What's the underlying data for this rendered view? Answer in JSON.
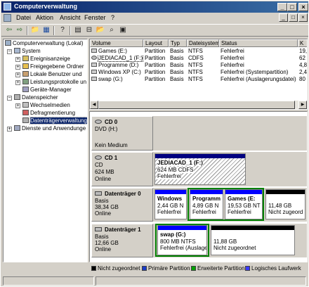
{
  "window": {
    "title": "Computerverwaltung"
  },
  "menu": {
    "items": [
      "Datei",
      "Aktion",
      "Ansicht",
      "Fenster",
      "?"
    ]
  },
  "tree": {
    "root": "Computerverwaltung (Lokal)",
    "system": "System",
    "system_children": [
      "Ereignisanzeige",
      "Freigegebene Ordner",
      "Lokale Benutzer und",
      "Leistungsprotokolle un",
      "Geräte-Manager"
    ],
    "storage": "Datenspeicher",
    "storage_children": [
      "Wechselmedien",
      "Defragmentierung",
      "Datenträgerverwaltung"
    ],
    "services": "Dienste und Anwendunge"
  },
  "list": {
    "columns": [
      "Volume",
      "Layout",
      "Typ",
      "Dateisystem",
      "Status",
      "K"
    ],
    "rows": [
      {
        "volume": "Games (E:)",
        "layout": "Partition",
        "typ": "Basis",
        "fs": "NTFS",
        "status": "Fehlerfrei",
        "k": "19,5"
      },
      {
        "volume": "JEDIACAD_1 (F:)",
        "layout": "Partition",
        "typ": "Basis",
        "fs": "CDFS",
        "status": "Fehlerfrei",
        "k": "62"
      },
      {
        "volume": "Programme (D:)",
        "layout": "Partition",
        "typ": "Basis",
        "fs": "NTFS",
        "status": "Fehlerfrei",
        "k": "4,8"
      },
      {
        "volume": "Windows XP (C:)",
        "layout": "Partition",
        "typ": "Basis",
        "fs": "NTFS",
        "status": "Fehlerfrei (Systempartition)",
        "k": "2,4"
      },
      {
        "volume": "swap (G:)",
        "layout": "Partition",
        "typ": "Basis",
        "fs": "NTFS",
        "status": "Fehlerfrei (Auslagerungsdatei)",
        "k": "80"
      }
    ]
  },
  "disks": {
    "cd0": {
      "name": "CD 0",
      "type": "DVD (H:)",
      "info": "",
      "status": "Kein Medium"
    },
    "cd1": {
      "name": "CD 1",
      "type": "CD",
      "info": "624 MB",
      "status": "Online",
      "part": {
        "name": "JEDIACAD_1 (F:)",
        "size": "624 MB CDFS",
        "status": "Fehlerfrei"
      }
    },
    "disk0": {
      "name": "Datenträger 0",
      "type": "Basis",
      "info": "38,34 GB",
      "status": "Online",
      "parts": [
        {
          "name": "Windows",
          "size": "2,44 GB N",
          "status": "Fehlerfrei"
        },
        {
          "name": "Programm",
          "size": "4,89 GB N",
          "status": "Fehlerfrei"
        },
        {
          "name": "Games (E:",
          "size": "19,53 GB NT",
          "status": "Fehlerfrei"
        },
        {
          "name": "",
          "size": "11,48 GB",
          "status": "Nicht zugeord"
        }
      ]
    },
    "disk1": {
      "name": "Datenträger 1",
      "type": "Basis",
      "info": "12,66 GB",
      "status": "Online",
      "parts": [
        {
          "name": "swap (G:)",
          "size": "800 MB NTFS",
          "status": "Fehlerfrei (Auslager"
        },
        {
          "name": "",
          "size": "11,88 GB",
          "status": "Nicht zugeordnet"
        }
      ]
    }
  },
  "legend": [
    {
      "label": "Nicht zugeordnet",
      "color": "#000000"
    },
    {
      "label": "Primäre Partition",
      "color": "#1a3cc8"
    },
    {
      "label": "Erweiterte Partition",
      "color": "#00a000"
    },
    {
      "label": "Logisches Laufwerk",
      "color": "#3a3aff"
    }
  ],
  "colors": {
    "primary": "#0000ff",
    "cdrom": "#000080",
    "unallocated": "#000000",
    "extended": "#008000"
  }
}
